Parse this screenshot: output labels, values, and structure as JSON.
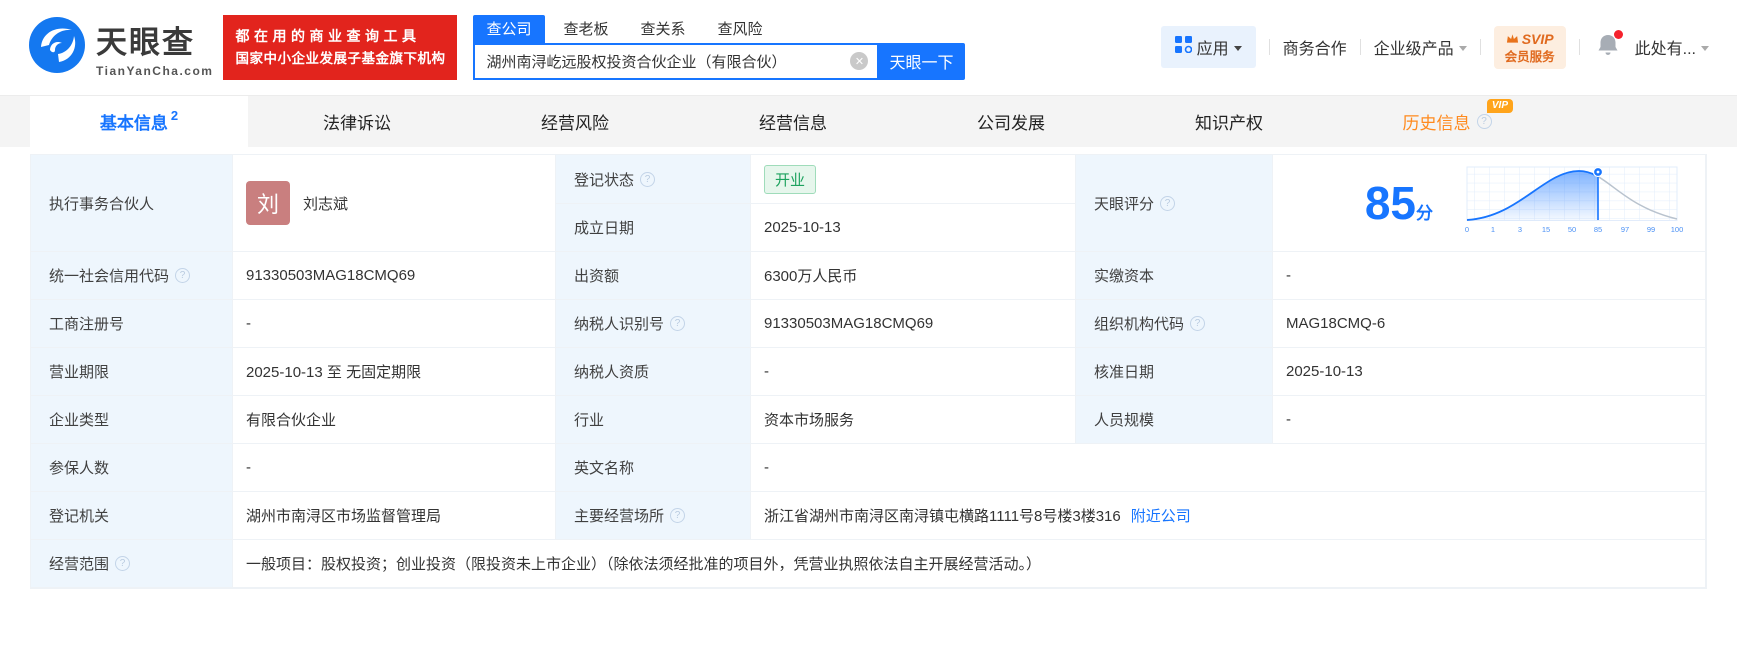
{
  "header": {
    "logo": {
      "brand": "天眼查",
      "domain": "TianYanCha.com"
    },
    "slogan_line1": "都在用的商业查询工具",
    "slogan_line2": "国家中小企业发展子基金旗下机构",
    "search": {
      "tabs": [
        "查公司",
        "查老板",
        "查关系",
        "查风险"
      ],
      "value": "湖州南浔屹远股权投资合伙企业（有限合伙）",
      "button": "天眼一下"
    },
    "nav": {
      "apps": "应用",
      "business": "商务合作",
      "enterprise": "企业级产品",
      "svip_line1": "SVIP",
      "svip_line2": "会员服务",
      "more": "此处有..."
    }
  },
  "tabs": [
    {
      "label": "基本信息",
      "badge": "2"
    },
    {
      "label": "法律诉讼"
    },
    {
      "label": "经营风险"
    },
    {
      "label": "经营信息"
    },
    {
      "label": "公司发展"
    },
    {
      "label": "知识产权"
    },
    {
      "label": "历史信息",
      "vip": "VIP"
    }
  ],
  "fields": {
    "partner": {
      "label": "执行事务合伙人",
      "avatar": "刘",
      "value": "刘志斌"
    },
    "reg_status": {
      "label": "登记状态",
      "value": "开业"
    },
    "est_date": {
      "label": "成立日期",
      "value": "2025-10-13"
    },
    "score": {
      "label": "天眼评分",
      "value": "85",
      "unit": "分"
    },
    "credit_code": {
      "label": "统一社会信用代码",
      "value": "91330503MAG18CMQ69"
    },
    "contribution": {
      "label": "出资额",
      "value": "6300万人民币"
    },
    "paid_capital": {
      "label": "实缴资本",
      "value": "-"
    },
    "reg_number": {
      "label": "工商注册号",
      "value": "-"
    },
    "taxpayer_id": {
      "label": "纳税人识别号",
      "value": "91330503MAG18CMQ69"
    },
    "org_code": {
      "label": "组织机构代码",
      "value": "MAG18CMQ-6"
    },
    "business_term": {
      "label": "营业期限",
      "value": "2025-10-13 至 无固定期限"
    },
    "taxpayer_quality": {
      "label": "纳税人资质",
      "value": "-"
    },
    "approval_date": {
      "label": "核准日期",
      "value": "2025-10-13"
    },
    "company_type": {
      "label": "企业类型",
      "value": "有限合伙企业"
    },
    "industry": {
      "label": "行业",
      "value": "资本市场服务"
    },
    "staff_size": {
      "label": "人员规模",
      "value": "-"
    },
    "insured_count": {
      "label": "参保人数",
      "value": "-"
    },
    "english_name": {
      "label": "英文名称",
      "value": "-"
    },
    "reg_authority": {
      "label": "登记机关",
      "value": "湖州市南浔区市场监督管理局"
    },
    "business_address": {
      "label": "主要经营场所",
      "value": "浙江省湖州市南浔区南浔镇屯横路1111号8号楼3楼316",
      "link": "附近公司"
    },
    "business_scope": {
      "label": "经营范围",
      "value": "一般项目：股权投资；创业投资（限投资未上市企业）（除依法须经批准的项目外，凭营业执照依法自主开展经营活动。）"
    }
  },
  "score_chart": {
    "type": "area",
    "description": "天眼评分分布曲线",
    "score": 85,
    "marker_at": 85,
    "ticks": [
      "0",
      "1",
      "3",
      "15",
      "50",
      "85",
      "97",
      "99",
      "100"
    ]
  }
}
